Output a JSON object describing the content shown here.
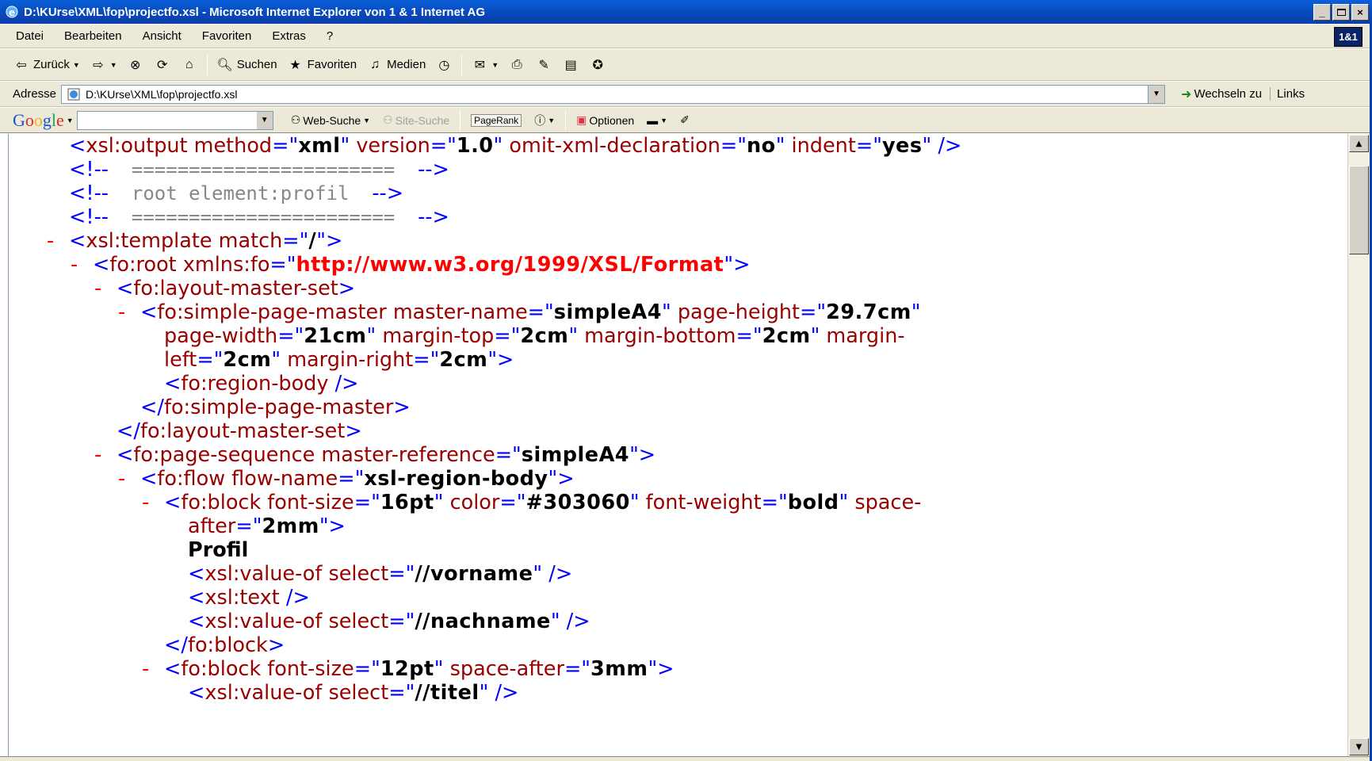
{
  "window": {
    "title": "D:\\KUrse\\XML\\fop\\projectfo.xsl - Microsoft Internet Explorer von 1 & 1 Internet AG",
    "buttons": [
      "_",
      " ",
      "×"
    ]
  },
  "menu": {
    "items": [
      "Datei",
      "Bearbeiten",
      "Ansicht",
      "Favoriten",
      "Extras",
      "?"
    ],
    "logo": "1&1"
  },
  "toolbar": {
    "back": "Zurück",
    "search": "Suchen",
    "favorites": "Favoriten",
    "media": "Medien"
  },
  "address": {
    "label": "Adresse",
    "value": "D:\\KUrse\\XML\\fop\\projectfo.xsl",
    "go": "Wechseln zu",
    "links": "Links"
  },
  "google": {
    "logo": "Google",
    "search_value": "",
    "web_search": "Web-Suche",
    "site_search": "Site-Suche",
    "pagerank": "PageRank",
    "options": "Optionen"
  },
  "code_lines": [
    {
      "indent": 0,
      "tokens": [
        [
          "b",
          "<"
        ],
        [
          "m",
          "xsl:output method"
        ],
        [
          "b",
          "=\""
        ],
        [
          "v",
          "xml"
        ],
        [
          "b",
          "\" "
        ],
        [
          "m",
          "version"
        ],
        [
          "b",
          "=\""
        ],
        [
          "v",
          "1.0"
        ],
        [
          "b",
          "\" "
        ],
        [
          "m",
          "omit-xml-declaration"
        ],
        [
          "b",
          "=\""
        ],
        [
          "v",
          "no"
        ],
        [
          "b",
          "\" "
        ],
        [
          "m",
          "indent"
        ],
        [
          "b",
          "=\""
        ],
        [
          "v",
          "yes"
        ],
        [
          "b",
          "\" />"
        ]
      ]
    },
    {
      "indent": 0,
      "tokens": [
        [
          "b",
          "<!--"
        ],
        [
          "cm",
          "  =======================  "
        ],
        [
          "b",
          "-->"
        ]
      ]
    },
    {
      "indent": 0,
      "tokens": [
        [
          "b",
          "<!--"
        ],
        [
          "cm",
          "  root element:profil  "
        ],
        [
          "b",
          "-->"
        ]
      ]
    },
    {
      "indent": 0,
      "tokens": [
        [
          "b",
          "<!--"
        ],
        [
          "cm",
          "  =======================  "
        ],
        [
          "b",
          "-->"
        ]
      ]
    },
    {
      "indent": 0,
      "minus": true,
      "tokens": [
        [
          "b",
          "<"
        ],
        [
          "m",
          "xsl:template match"
        ],
        [
          "b",
          "=\""
        ],
        [
          "v",
          "/"
        ],
        [
          "b",
          "\">"
        ]
      ]
    },
    {
      "indent": 1,
      "minus": true,
      "tokens": [
        [
          "b",
          "<"
        ],
        [
          "m",
          "fo:root "
        ],
        [
          "m",
          "xmlns:fo"
        ],
        [
          "b",
          "=\""
        ],
        [
          "vr",
          "http://www.w3.org/1999/XSL/Format"
        ],
        [
          "b",
          "\">"
        ]
      ]
    },
    {
      "indent": 2,
      "minus": true,
      "tokens": [
        [
          "b",
          "<"
        ],
        [
          "m",
          "fo:layout-master-set"
        ],
        [
          "b",
          ">"
        ]
      ]
    },
    {
      "indent": 3,
      "minus": true,
      "tokens": [
        [
          "b",
          "<"
        ],
        [
          "m",
          "fo:simple-page-master master-name"
        ],
        [
          "b",
          "=\""
        ],
        [
          "v",
          "simpleA4"
        ],
        [
          "b",
          "\" "
        ],
        [
          "m",
          "page-height"
        ],
        [
          "b",
          "=\""
        ],
        [
          "v",
          "29.7cm"
        ],
        [
          "b",
          "\""
        ]
      ]
    },
    {
      "indent": 4,
      "tokens": [
        [
          "m",
          "page-width"
        ],
        [
          "b",
          "=\""
        ],
        [
          "v",
          "21cm"
        ],
        [
          "b",
          "\" "
        ],
        [
          "m",
          "margin-top"
        ],
        [
          "b",
          "=\""
        ],
        [
          "v",
          "2cm"
        ],
        [
          "b",
          "\" "
        ],
        [
          "m",
          "margin-bottom"
        ],
        [
          "b",
          "=\""
        ],
        [
          "v",
          "2cm"
        ],
        [
          "b",
          "\" "
        ],
        [
          "m",
          "margin-"
        ]
      ]
    },
    {
      "indent": 4,
      "tokens": [
        [
          "m",
          "left"
        ],
        [
          "b",
          "=\""
        ],
        [
          "v",
          "2cm"
        ],
        [
          "b",
          "\" "
        ],
        [
          "m",
          "margin-right"
        ],
        [
          "b",
          "=\""
        ],
        [
          "v",
          "2cm"
        ],
        [
          "b",
          "\">"
        ]
      ]
    },
    {
      "indent": 4,
      "tokens": [
        [
          "b",
          "<"
        ],
        [
          "m",
          "fo:region-body"
        ],
        [
          "b",
          " />"
        ]
      ]
    },
    {
      "indent": 3,
      "tokens": [
        [
          "b",
          "</"
        ],
        [
          "m",
          "fo:simple-page-master"
        ],
        [
          "b",
          ">"
        ]
      ]
    },
    {
      "indent": 2,
      "tokens": [
        [
          "b",
          "</"
        ],
        [
          "m",
          "fo:layout-master-set"
        ],
        [
          "b",
          ">"
        ]
      ]
    },
    {
      "indent": 2,
      "minus": true,
      "tokens": [
        [
          "b",
          "<"
        ],
        [
          "m",
          "fo:page-sequence master-reference"
        ],
        [
          "b",
          "=\""
        ],
        [
          "v",
          "simpleA4"
        ],
        [
          "b",
          "\">"
        ]
      ]
    },
    {
      "indent": 3,
      "minus": true,
      "tokens": [
        [
          "b",
          "<"
        ],
        [
          "m",
          "fo:flow flow-name"
        ],
        [
          "b",
          "=\""
        ],
        [
          "v",
          "xsl-region-body"
        ],
        [
          "b",
          "\">"
        ]
      ]
    },
    {
      "indent": 4,
      "minus": true,
      "tokens": [
        [
          "b",
          "<"
        ],
        [
          "m",
          "fo:block font-size"
        ],
        [
          "b",
          "=\""
        ],
        [
          "v",
          "16pt"
        ],
        [
          "b",
          "\" "
        ],
        [
          "m",
          "color"
        ],
        [
          "b",
          "=\""
        ],
        [
          "v",
          "#303060"
        ],
        [
          "b",
          "\" "
        ],
        [
          "m",
          "font-weight"
        ],
        [
          "b",
          "=\""
        ],
        [
          "v",
          "bold"
        ],
        [
          "b",
          "\" "
        ],
        [
          "m",
          "space-"
        ]
      ]
    },
    {
      "indent": 5,
      "tokens": [
        [
          "m",
          "after"
        ],
        [
          "b",
          "=\""
        ],
        [
          "v",
          "2mm"
        ],
        [
          "b",
          "\">"
        ]
      ]
    },
    {
      "indent": 5,
      "tokens": [
        [
          "tx",
          "Profil"
        ]
      ]
    },
    {
      "indent": 5,
      "tokens": [
        [
          "b",
          "<"
        ],
        [
          "m",
          "xsl:value-of select"
        ],
        [
          "b",
          "=\""
        ],
        [
          "v",
          "//vorname"
        ],
        [
          "b",
          "\" />"
        ]
      ]
    },
    {
      "indent": 5,
      "tokens": [
        [
          "b",
          "<"
        ],
        [
          "m",
          "xsl:text"
        ],
        [
          "b",
          " />"
        ]
      ]
    },
    {
      "indent": 5,
      "tokens": [
        [
          "b",
          "<"
        ],
        [
          "m",
          "xsl:value-of select"
        ],
        [
          "b",
          "=\""
        ],
        [
          "v",
          "//nachname"
        ],
        [
          "b",
          "\" />"
        ]
      ]
    },
    {
      "indent": 4,
      "tokens": [
        [
          "b",
          "</"
        ],
        [
          "m",
          "fo:block"
        ],
        [
          "b",
          ">"
        ]
      ]
    },
    {
      "indent": 4,
      "minus": true,
      "tokens": [
        [
          "b",
          "<"
        ],
        [
          "m",
          "fo:block font-size"
        ],
        [
          "b",
          "=\""
        ],
        [
          "v",
          "12pt"
        ],
        [
          "b",
          "\" "
        ],
        [
          "m",
          "space-after"
        ],
        [
          "b",
          "=\""
        ],
        [
          "v",
          "3mm"
        ],
        [
          "b",
          "\">"
        ]
      ]
    },
    {
      "indent": 5,
      "tokens": [
        [
          "b",
          "<"
        ],
        [
          "m",
          "xsl:value-of select"
        ],
        [
          "b",
          "=\""
        ],
        [
          "v",
          "//titel"
        ],
        [
          "b",
          "\" />"
        ]
      ]
    }
  ]
}
